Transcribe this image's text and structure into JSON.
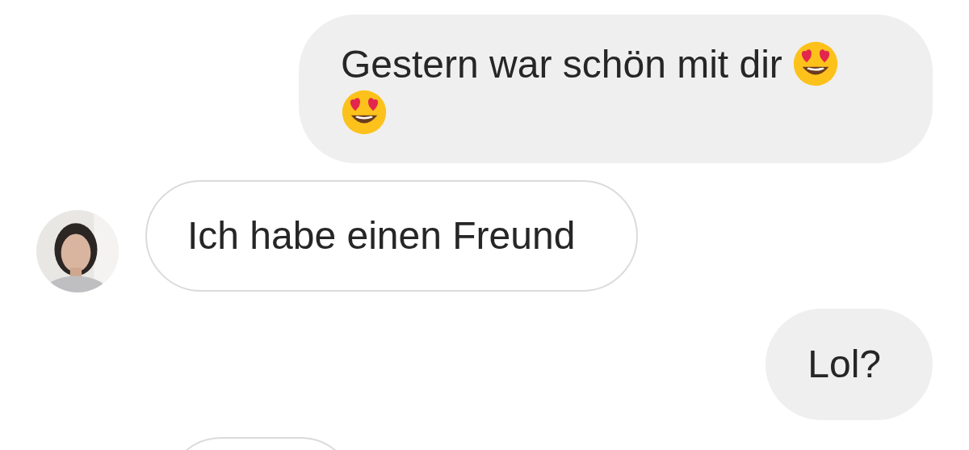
{
  "messages": [
    {
      "kind": "outgoing",
      "text": "Gestern war schön mit dir",
      "emojis": [
        {
          "kind": "heart_eyes"
        },
        {
          "kind": "heart_eyes"
        }
      ]
    },
    {
      "kind": "incoming_avatar",
      "text": "Ich habe einen Freund"
    },
    {
      "kind": "outgoing",
      "text": "Lol?"
    },
    {
      "kind": "incoming"
    }
  ]
}
